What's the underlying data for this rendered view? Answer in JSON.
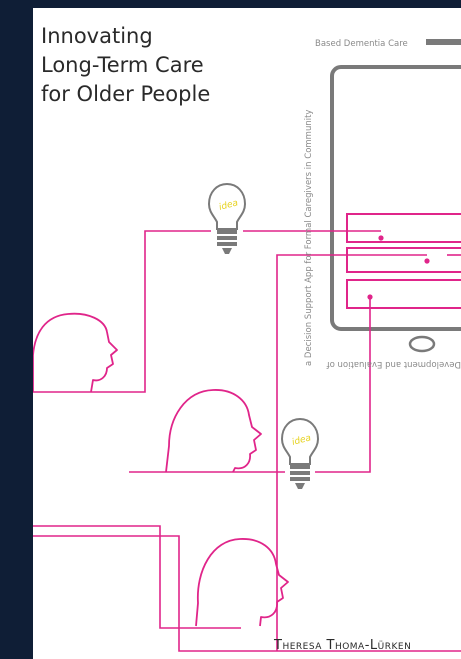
{
  "book": {
    "title_lines": [
      "Innovating",
      "Long-Term Care",
      "for Older People"
    ],
    "subtitle_part1": "a Decision Support App for Formal Caregivers in Community",
    "subtitle_part2": "Based Dementia Care",
    "subtitle_part3": "Development and Evaluation of",
    "author": "Theresa Thoma-Lürken",
    "idea_label": "idea"
  },
  "colors": {
    "background": "#0f1e36",
    "accent": "#e0258a",
    "outline": "#7a7a7a",
    "bulb_text": "#e6d21c"
  }
}
